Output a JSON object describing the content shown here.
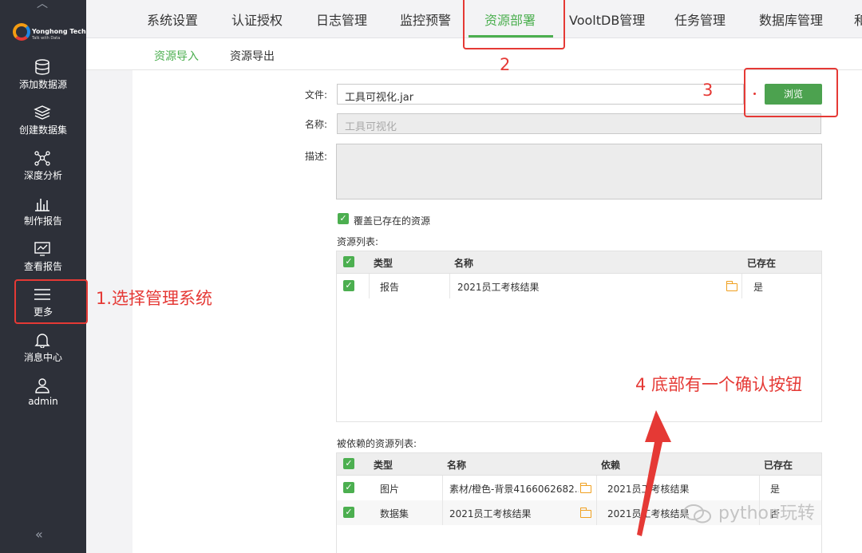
{
  "brand": {
    "name": "Yonghong Tech",
    "tagline": "Talk with Data"
  },
  "sidebar": {
    "items": [
      {
        "label": "添加数据源",
        "icon": "database-icon"
      },
      {
        "label": "创建数据集",
        "icon": "layers-icon"
      },
      {
        "label": "深度分析",
        "icon": "network-icon"
      },
      {
        "label": "制作报告",
        "icon": "bar-chart-icon"
      },
      {
        "label": "查看报告",
        "icon": "monitor-chart-icon"
      },
      {
        "label": "更多",
        "icon": "menu-icon"
      },
      {
        "label": "消息中心",
        "icon": "bell-icon"
      },
      {
        "label": "admin",
        "icon": "user-icon"
      }
    ],
    "collapse": "«"
  },
  "topnav": {
    "tabs": [
      "系统设置",
      "认证授权",
      "日志管理",
      "监控预警",
      "资源部署",
      "VooltDB管理",
      "任务管理",
      "数据库管理",
      "和"
    ],
    "active_index": 4
  },
  "subnav": {
    "tabs": [
      "资源导入",
      "资源导出"
    ],
    "active_index": 0
  },
  "form": {
    "file_label": "文件:",
    "file_value": "工具可视化.jar",
    "browse_label": "浏览",
    "name_label": "名称:",
    "name_value": "工具可视化",
    "desc_label": "描述:",
    "overwrite_label": "覆盖已存在的资源",
    "overwrite_checked": true
  },
  "resource_list": {
    "title": "资源列表:",
    "headers": [
      "类型",
      "名称",
      "已存在"
    ],
    "rows": [
      {
        "type": "报告",
        "name": "2021员工考核结果",
        "exists": "是"
      }
    ]
  },
  "dependency_list": {
    "title": "被依赖的资源列表:",
    "headers": [
      "类型",
      "名称",
      "依赖",
      "已存在"
    ],
    "rows": [
      {
        "type": "图片",
        "name": "素材/橙色-背景4166062682..",
        "dep": "2021员工考核结果",
        "exists": "是"
      },
      {
        "type": "数据集",
        "name": "2021员工考核结果",
        "dep": "2021员工考核结果",
        "exists": "否"
      }
    ]
  },
  "annotations": {
    "a1": "1.选择管理系统",
    "a2": "2",
    "a3": "3",
    "a4": "4  底部有一个确认按钮",
    "color": "#e53935"
  },
  "watermark": "python玩转"
}
